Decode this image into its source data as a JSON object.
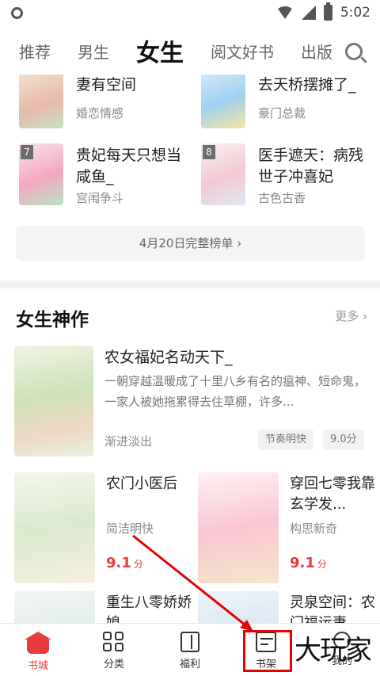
{
  "status_bar": {
    "time": "5:02"
  },
  "top_tabs": [
    {
      "label": "推荐"
    },
    {
      "label": "男生"
    },
    {
      "label": "女生",
      "active": true
    },
    {
      "label": "阅文好书"
    },
    {
      "label": "出版"
    }
  ],
  "ranking": {
    "items": [
      {
        "rank": "",
        "title": "重生八零：妍妻有空间",
        "title_visible": "妻有空间",
        "genre": "婚恋情感"
      },
      {
        "rank": "",
        "title": "…去天桥摆摊了_",
        "title_visible": "去天桥摆摊了_",
        "genre": "豪门总裁"
      },
      {
        "rank": "7",
        "title": "贵妃每天只想当咸鱼_",
        "genre": "宫闱争斗"
      },
      {
        "rank": "8",
        "title": "医手遮天：病残世子冲喜妃",
        "genre": "古色古香"
      }
    ],
    "full_list_label": "4月20日完整榜单 ›"
  },
  "section": {
    "title": "女生神作",
    "more_label": "更多 ›"
  },
  "feature_book": {
    "title": "农女福妃名动天下_",
    "description": "一朝穿越温暖成了十里八乡有名的瘟神、短命鬼，一家人被她拖累得去住草棚，许多...",
    "author": "渐进淡出",
    "tags": [
      "节奏明快",
      "9.0分"
    ]
  },
  "grid_books": [
    {
      "title": "农门小医后",
      "style": "简洁明快",
      "score": "9.1",
      "score_unit": "分"
    },
    {
      "title": "穿回七零我靠玄学发...",
      "style": "构思新奇",
      "score": "9.1",
      "score_unit": "分"
    },
    {
      "title": "重生八零娇娇媳",
      "style": "",
      "score": "",
      "score_unit": ""
    },
    {
      "title": "灵泉空间：农门福运妻",
      "style": "",
      "score": "",
      "score_unit": ""
    }
  ],
  "bottom_nav": [
    {
      "label": "书城",
      "icon": "home-icon",
      "active": true
    },
    {
      "label": "分类",
      "icon": "category-icon"
    },
    {
      "label": "福利",
      "icon": "gift-icon"
    },
    {
      "label": "书架",
      "icon": "bookshelf-icon"
    },
    {
      "label": "我的",
      "icon": "profile-icon"
    }
  ],
  "watermark": "大玩家",
  "colors": {
    "accent": "#e83b3b",
    "annotation": "#e30000"
  }
}
